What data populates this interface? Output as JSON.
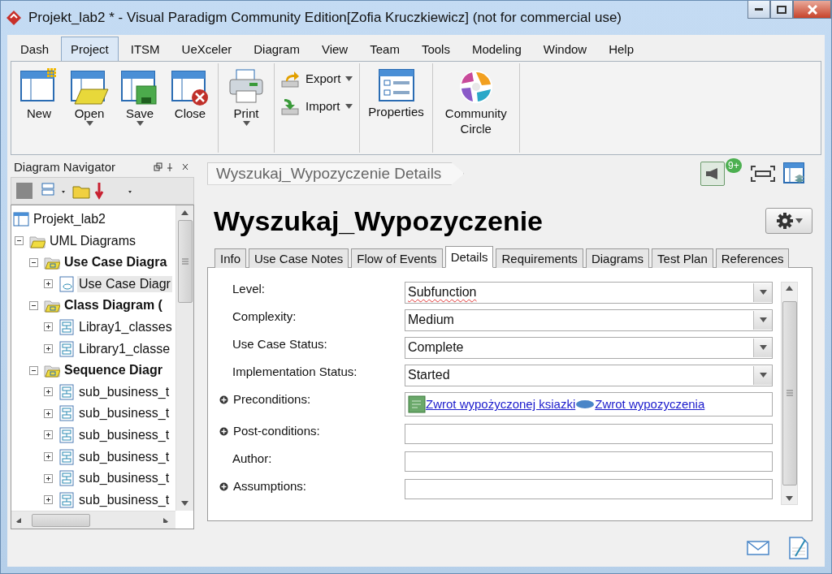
{
  "window": {
    "title": "Projekt_lab2 * - Visual Paradigm Community Edition[Zofia Kruczkiewicz] (not for commercial use)"
  },
  "menu_tabs": [
    {
      "label": "Dash",
      "selected": false
    },
    {
      "label": "Project",
      "selected": true
    },
    {
      "label": "ITSM",
      "selected": false
    },
    {
      "label": "UeXceler",
      "selected": false
    },
    {
      "label": "Diagram",
      "selected": false
    },
    {
      "label": "View",
      "selected": false
    },
    {
      "label": "Team",
      "selected": false
    },
    {
      "label": "Tools",
      "selected": false
    },
    {
      "label": "Modeling",
      "selected": false
    },
    {
      "label": "Window",
      "selected": false
    },
    {
      "label": "Help",
      "selected": false
    }
  ],
  "ribbon": [
    {
      "buttons": [
        {
          "kind": "new",
          "label": "New",
          "dropdown": false
        },
        {
          "kind": "open",
          "label": "Open",
          "dropdown": true
        },
        {
          "kind": "save",
          "label": "Save",
          "dropdown": true
        },
        {
          "kind": "close",
          "label": "Close",
          "dropdown": false
        }
      ]
    },
    {
      "buttons": [
        {
          "kind": "print",
          "label": "Print",
          "dropdown": true
        }
      ]
    },
    {
      "buttons": [
        {
          "kind": "export",
          "label": "Export",
          "dropdown": true
        },
        {
          "kind": "import",
          "label": "Import",
          "dropdown": true
        }
      ]
    },
    {
      "buttons": [
        {
          "kind": "properties",
          "label": "Properties",
          "dropdown": false
        }
      ]
    },
    {
      "buttons": [
        {
          "kind": "community",
          "label": "Community Circle",
          "dropdown": false
        }
      ]
    }
  ],
  "navigator": {
    "title": "Diagram Navigator",
    "tree": [
      {
        "label": "Projekt_lab2",
        "kind": "project",
        "selected": false,
        "children": [
          {
            "label": "UML Diagrams",
            "kind": "folder",
            "selected": false,
            "expanded": true,
            "children": [
              {
                "label": "Use Case Diagra",
                "kind": "model",
                "selected": false,
                "expanded": true,
                "children": [
                  {
                    "label": "Use Case Diagr",
                    "kind": "usecase",
                    "selected": true,
                    "expanded": false
                  }
                ]
              },
              {
                "label": "Class Diagram (",
                "kind": "model",
                "selected": false,
                "expanded": true,
                "children": [
                  {
                    "label": "Libray1_classes",
                    "kind": "class",
                    "selected": false,
                    "expanded": false
                  },
                  {
                    "label": "Library1_classe",
                    "kind": "class",
                    "selected": false,
                    "expanded": false
                  }
                ]
              },
              {
                "label": "Sequence Diagr",
                "kind": "model",
                "selected": false,
                "expanded": true,
                "children": [
                  {
                    "label": "sub_business_t",
                    "kind": "sequence",
                    "selected": false,
                    "expanded": false
                  },
                  {
                    "label": "sub_business_t",
                    "kind": "sequence",
                    "selected": false,
                    "expanded": false
                  },
                  {
                    "label": "sub_business_t",
                    "kind": "sequence",
                    "selected": false,
                    "expanded": false
                  },
                  {
                    "label": "sub_business_t",
                    "kind": "sequence",
                    "selected": false,
                    "expanded": false
                  },
                  {
                    "label": "sub_business_t",
                    "kind": "sequence",
                    "selected": false,
                    "expanded": false
                  },
                  {
                    "label": "sub_business_t",
                    "kind": "sequence",
                    "selected": false,
                    "expanded": false
                  }
                ]
              }
            ]
          }
        ]
      }
    ]
  },
  "breadcrumb": "Wyszukaj_Wypozyczenie Details",
  "notification_badge": "9+",
  "heading": "Wyszukaj_Wypozyczenie",
  "tabs": [
    {
      "label": "Info",
      "selected": false
    },
    {
      "label": "Use Case Notes",
      "selected": false
    },
    {
      "label": "Flow of Events",
      "selected": false
    },
    {
      "label": "Details",
      "selected": true
    },
    {
      "label": "Requirements",
      "selected": false
    },
    {
      "label": "Diagrams",
      "selected": false
    },
    {
      "label": "Test Plan",
      "selected": false
    },
    {
      "label": "References",
      "selected": false
    }
  ],
  "fields": [
    {
      "kind": "select",
      "label": "Level:",
      "value": "Subfunction",
      "misspelled": true,
      "expandable": false
    },
    {
      "kind": "select",
      "label": "Complexity:",
      "value": "Medium",
      "misspelled": false,
      "expandable": false
    },
    {
      "kind": "select",
      "label": "Use Case Status:",
      "value": "Complete",
      "misspelled": false,
      "expandable": false
    },
    {
      "kind": "select",
      "label": "Implementation Status:",
      "value": "Started",
      "misspelled": false,
      "expandable": false
    },
    {
      "kind": "links",
      "label": "Preconditions:",
      "expandable": true,
      "links": [
        {
          "kind": "note",
          "text": "Zwrot wypożyczonej ksiazki"
        },
        {
          "kind": "usecase",
          "text": "Zwrot wypozyczenia"
        }
      ]
    },
    {
      "kind": "text",
      "label": "Post-conditions:",
      "expandable": true
    },
    {
      "kind": "text",
      "label": "Author:",
      "expandable": false
    },
    {
      "kind": "text",
      "label": "Assumptions:",
      "expandable": true
    }
  ]
}
